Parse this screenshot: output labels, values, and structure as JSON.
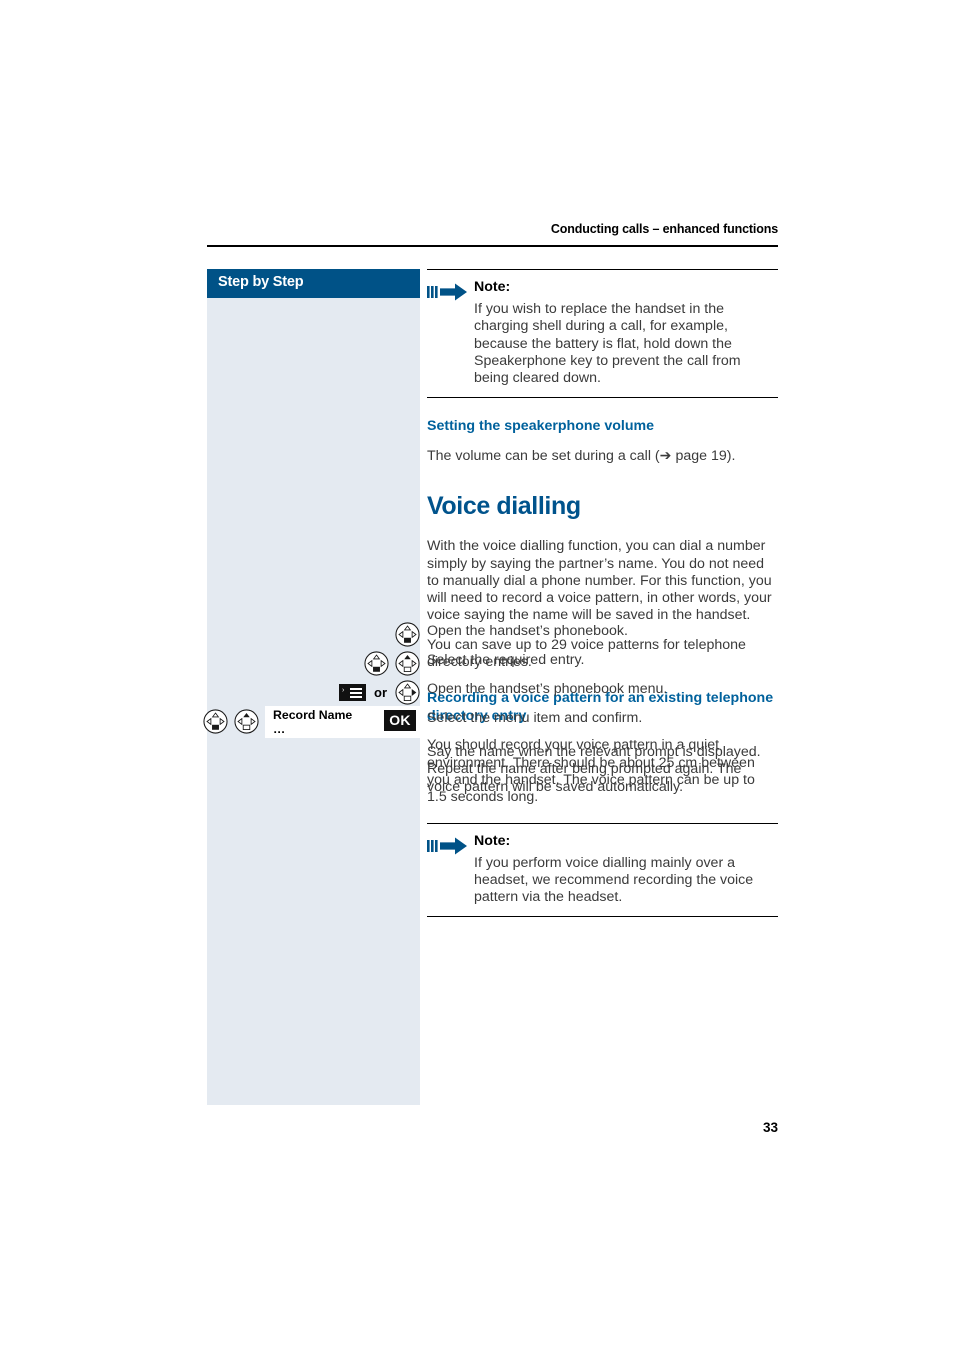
{
  "page": {
    "running_head": "Conducting calls – enhanced functions",
    "folio": "33"
  },
  "sidebar": {
    "header_label": "Step by Step"
  },
  "colors": {
    "accent_dark_blue": "#005287",
    "heading_blue": "#00538c",
    "subheading_blue": "#00619c",
    "sidebar_bg": "#e4eaf1",
    "body_text": "#3b3b3b"
  },
  "content": {
    "note1": {
      "title": "Note:",
      "body": "If you wish to replace the handset in the charging shell during a call, for example, because the battery is flat, hold down the Speakerphone key to prevent the call from being cleared down."
    },
    "speakerphone_heading": "Setting the speakerphone volume",
    "speakerphone_body": "The volume can be set during a call (➔ page 19).",
    "voice_dialling_heading": "Voice dialling",
    "voice_dialling_p1": "With the voice dialling function, you can dial a number simply by saying the partner’s name. You do not need to manually dial a phone number. For this function, you will need to record a voice pattern, in other words, your voice saying the name will be saved in the handset.",
    "voice_dialling_p2": "You can save up to 29 voice patterns for telephone directory entries.",
    "recording_heading": "Recording a voice pattern for an existing telephone directory entry",
    "recording_body": "You should record your voice pattern in a quiet environment. There should be about 25 cm between you and the handset. The voice pattern can be up to 1.5 seconds long.",
    "note2": {
      "title": "Note:",
      "body": "If you perform voice dialling mainly over a headset, we recommend recording the voice pattern via the headset."
    },
    "closing_paragraph": "Say the name when the relevant prompt is displayed. Repeat the name after being prompted again. The voice pattern will be saved automatically."
  },
  "steps": [
    {
      "text": "Open the handset’s phonebook."
    },
    {
      "text": "Select the required entry."
    },
    {
      "text": "Open the handset’s phonebook menu.",
      "or_label": "or"
    },
    {
      "text": "Select the menu item and confirm."
    }
  ],
  "display": {
    "title": "Record Name",
    "dots": "…",
    "ok_label": "OK",
    "menu_caret": "›"
  }
}
